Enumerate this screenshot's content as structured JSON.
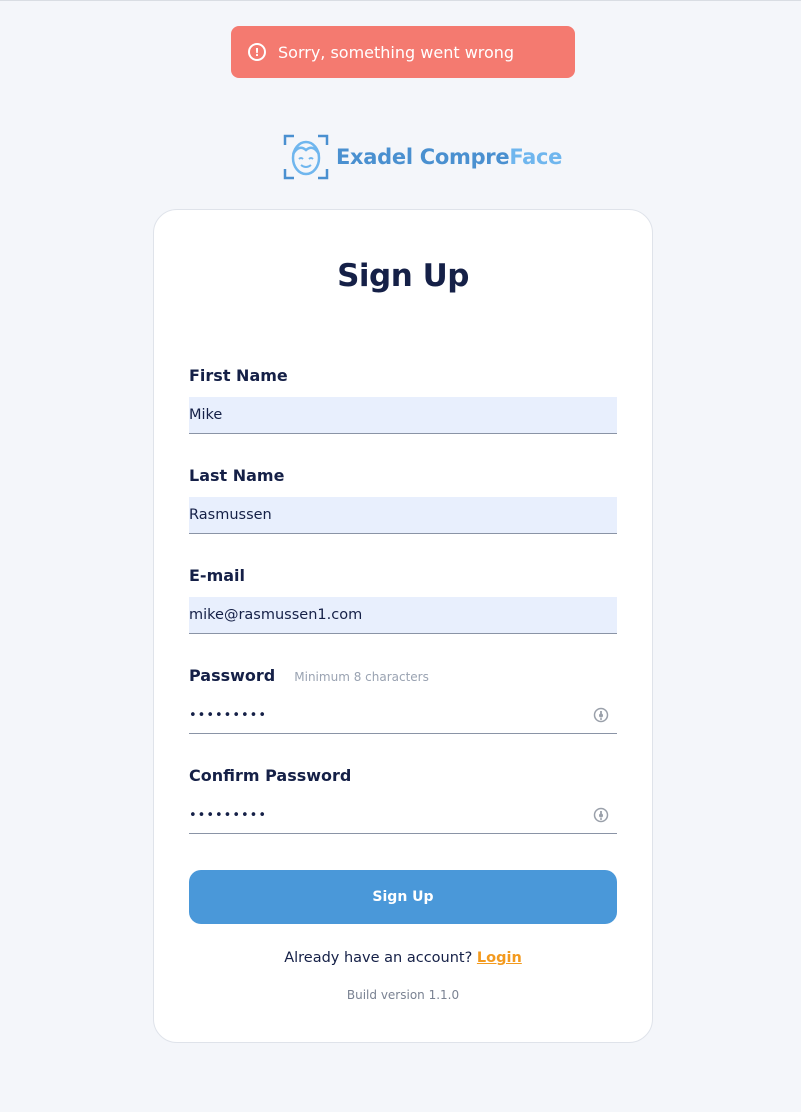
{
  "toast": {
    "message": "Sorry, something went wrong",
    "color": "#f47a70"
  },
  "brand": {
    "part1": "Exadel ",
    "part2": "Compre",
    "part3": "Face"
  },
  "form": {
    "title": "Sign Up",
    "first_name": {
      "label": "First Name",
      "value": "Mike"
    },
    "last_name": {
      "label": "Last Name",
      "value": "Rasmussen"
    },
    "email": {
      "label": "E-mail",
      "value": "mike@rasmussen1.com"
    },
    "password": {
      "label": "Password",
      "hint": "Minimum 8 characters",
      "value": "•••••••••",
      "toggle_icon": "eye-toggle-icon"
    },
    "confirm_password": {
      "label": "Confirm Password",
      "value": "•••••••••",
      "toggle_icon": "eye-toggle-icon"
    },
    "submit_label": "Sign Up",
    "login_prompt": "Already have an account?",
    "login_link": "Login",
    "build_version": "Build version 1.1.0"
  },
  "colors": {
    "accent": "#4a98d9",
    "link": "#f39a1e",
    "title": "#152047"
  }
}
